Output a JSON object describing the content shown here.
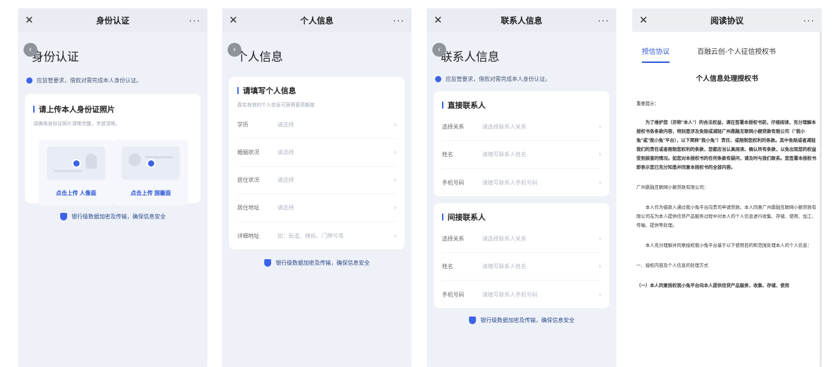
{
  "common": {
    "close_glyph": "✕",
    "more_glyph": "···",
    "secure_text": "银行级数据加密及传输，确保信息安全",
    "chevron": "›",
    "accent_color": "#3a63e8"
  },
  "screen1": {
    "nav_title": "身份认证",
    "page_title": "身份认证",
    "tip": "应监管要求，借款对需完成本人身份认证。",
    "card_title": "请上传本人身份证照片",
    "card_sub": "请确保身份证照片清晰完整，字迹清晰。",
    "upload_front": "点击上传 人像面",
    "upload_back": "点击上传 国徽面"
  },
  "screen2": {
    "nav_title": "个人信息",
    "page_title": "个人信息",
    "card_title": "请填写个人信息",
    "card_sub": "真实有效的个人信息可获得更高额度",
    "rows": [
      {
        "label": "学历",
        "value": "请选择"
      },
      {
        "label": "婚姻状况",
        "value": "请选择"
      },
      {
        "label": "居住状况",
        "value": "请选择"
      },
      {
        "label": "居住地址",
        "value": "请选择"
      },
      {
        "label": "详细地址",
        "value": "如：街道、楼栋、门牌号等"
      }
    ]
  },
  "screen3": {
    "nav_title": "联系人信息",
    "page_title": "联系人信息",
    "tip": "应监管要求，借款对需完成本人身份认证。",
    "direct_title": "直接联系人",
    "direct_rows": [
      {
        "label": "选择关系",
        "value": "请选择联系人关系"
      },
      {
        "label": "姓名",
        "value": "请填写联系人姓名"
      },
      {
        "label": "手机号码",
        "value": "请填写联系人手机号码"
      }
    ],
    "indirect_title": "间接联系人",
    "indirect_rows": [
      {
        "label": "选择关系",
        "value": "请选择联系人关系"
      },
      {
        "label": "姓名",
        "value": "请填写联系人姓名"
      },
      {
        "label": "手机号码",
        "value": "请填写联系人手机号码"
      }
    ]
  },
  "screen4": {
    "nav_title": "阅读协议",
    "tab1": "授信协议",
    "tab2": "百融云创-个人征信授权书",
    "doc_title": "个人信息处理授权书",
    "greeting": "重要提示：",
    "para1": "为了维护您（亦称\"本人\"）的合法权益，请在签署本授权书前，仔细阅读、充分理解本授权书各条款内容，特别是涉及免除或减轻广州鼎融互联网小额贷款有限公司（\"我小兔\"或\"我小兔\"平台），以下简称\"我小兔\"）责任、或限制您权利的条款。其中免除或者减轻我们的责任或者限制您权利的条款，您都应当认真阅读、确认所有条款，以免出现您的权益受到损害的情况。如您对本授权书的任何条款有疑问，请及时与我们联系。您签署本授权书即表示您已充分知悉并同意本授权书的全部内容。",
    "addressee": "广州鼎融互联网小额贷款有限公司：",
    "para2": "本人作为借款人通过我小兔平台向贵司申请贷款。本人同意广州鼎融互联网小额贷款有限公司在为本人提供信贷产品服务过程中对本人的个人信息进行收集、存储、使用、加工、传输、提供等处理。",
    "para3": "本人充分理解并同意授权我小兔平台基于以下使用目的和范围处理本人的个人信息：",
    "section1": "一、授权内容及个人信息的处理方式",
    "section2": "（一）本人同意授权我小兔平台向本人提供信贷产品服务，收集、存储、使用"
  }
}
